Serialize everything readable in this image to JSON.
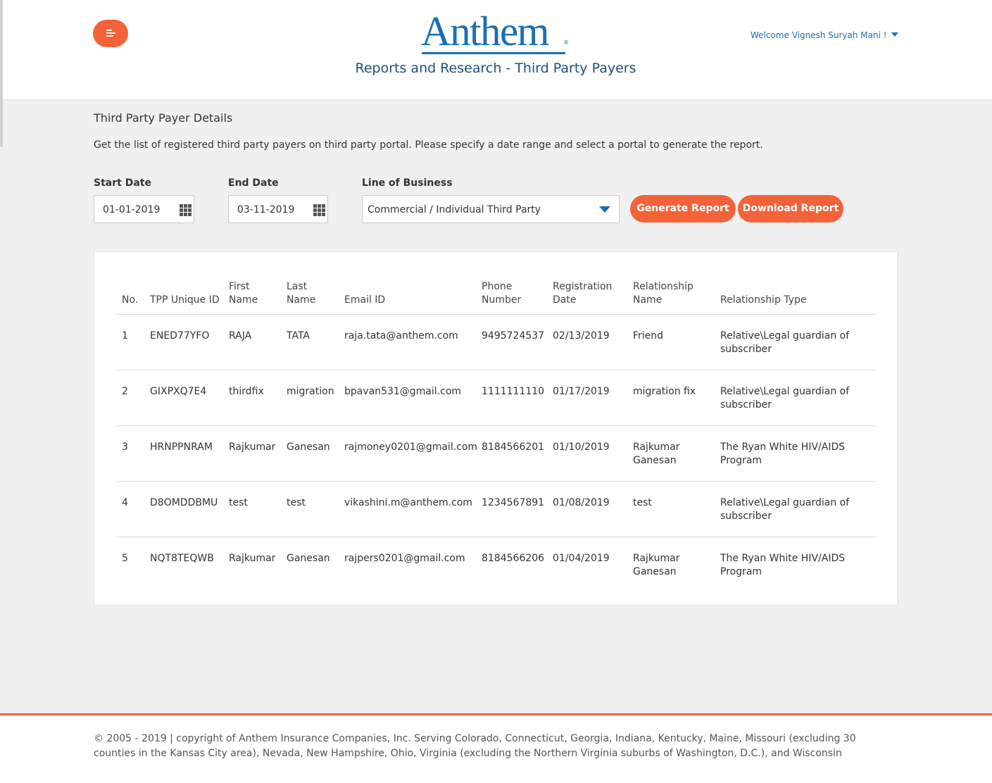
{
  "header": {
    "logo_text": "Anthem",
    "logo_mark": "®",
    "title": "Reports and Research - Third Party Payers",
    "welcome": "Welcome Vignesh Suryah Mani !"
  },
  "main": {
    "section_title": "Third Party Payer Details",
    "description": "Get the list of registered third party payers on third party portal. Please specify a date range and select a portal to generate the report.",
    "form": {
      "start_date_label": "Start Date",
      "start_date_value": "01-01-2019",
      "end_date_label": "End Date",
      "end_date_value": "03-11-2019",
      "lob_label": "Line of Business",
      "lob_value": "Commercial / Individual Third Party",
      "generate_label": "Generate Report",
      "download_label": "Download Report"
    },
    "table": {
      "headers": [
        [
          "No."
        ],
        [
          "TPP Unique ID"
        ],
        [
          "First",
          "Name"
        ],
        [
          "Last",
          "Name"
        ],
        [
          "Email ID"
        ],
        [
          "Phone",
          "Number"
        ],
        [
          "Registration",
          "Date"
        ],
        [
          "Relationship",
          "Name"
        ],
        [
          "Relationship Type"
        ]
      ],
      "rows": [
        {
          "no": "1",
          "tpp_id": "ENED77YFO",
          "first_name": "RAJA",
          "last_name": "TATA",
          "email": "raja.tata@anthem.com",
          "phone": "9495724537",
          "reg_date": "02/13/2019",
          "rel_name": [
            "Friend"
          ],
          "rel_type": [
            "Relative\\Legal guardian of",
            "subscriber"
          ]
        },
        {
          "no": "2",
          "tpp_id": "GIXPXQ7E4",
          "first_name": "thirdfix",
          "last_name": "migration",
          "email": "bpavan531@gmail.com",
          "phone": "1111111110",
          "reg_date": "01/17/2019",
          "rel_name": [
            "migration fix"
          ],
          "rel_type": [
            "Relative\\Legal guardian of",
            "subscriber"
          ]
        },
        {
          "no": "3",
          "tpp_id": "HRNPPNRAM",
          "first_name": "Rajkumar",
          "last_name": "Ganesan",
          "email": "rajmoney0201@gmail.com",
          "phone": "8184566201",
          "reg_date": "01/10/2019",
          "rel_name": [
            "Rajkumar",
            "Ganesan"
          ],
          "rel_type": [
            "The Ryan White HIV/AIDS",
            "Program"
          ]
        },
        {
          "no": "4",
          "tpp_id": "D8OMDDBMU",
          "first_name": "test",
          "last_name": "test",
          "email": "vikashini.m@anthem.com",
          "phone": "1234567891",
          "reg_date": "01/08/2019",
          "rel_name": [
            "test"
          ],
          "rel_type": [
            "Relative\\Legal guardian of",
            "subscriber"
          ]
        },
        {
          "no": "5",
          "tpp_id": "NQT8TEQWB",
          "first_name": "Rajkumar",
          "last_name": "Ganesan",
          "email": "rajpers0201@gmail.com",
          "phone": "8184566206",
          "reg_date": "01/04/2019",
          "rel_name": [
            "Rajkumar",
            "Ganesan"
          ],
          "rel_type": [
            "The Ryan White HIV/AIDS",
            "Program"
          ]
        }
      ]
    }
  },
  "footer": {
    "text": "© 2005 - 2019 | copyright of Anthem Insurance Companies, Inc. Serving Colorado, Connecticut, Georgia, Indiana, Kentucky, Maine, Missouri (excluding 30 counties in the Kansas City area), Nevada, New Hampshire, Ohio, Virginia (excluding the Northern Virginia suburbs of Washington, D.C.), and Wisconsin"
  },
  "icons": {
    "menu": "menu-icon",
    "calendar": "calendar-grid-icon",
    "dropdown": "chevron-down-icon",
    "user_menu": "caret-down-icon"
  },
  "colors": {
    "accent": "#f4623a",
    "brand_blue": "#1a6fb4",
    "title_blue": "#1f4e79",
    "page_bg": "#f0f0f0"
  }
}
